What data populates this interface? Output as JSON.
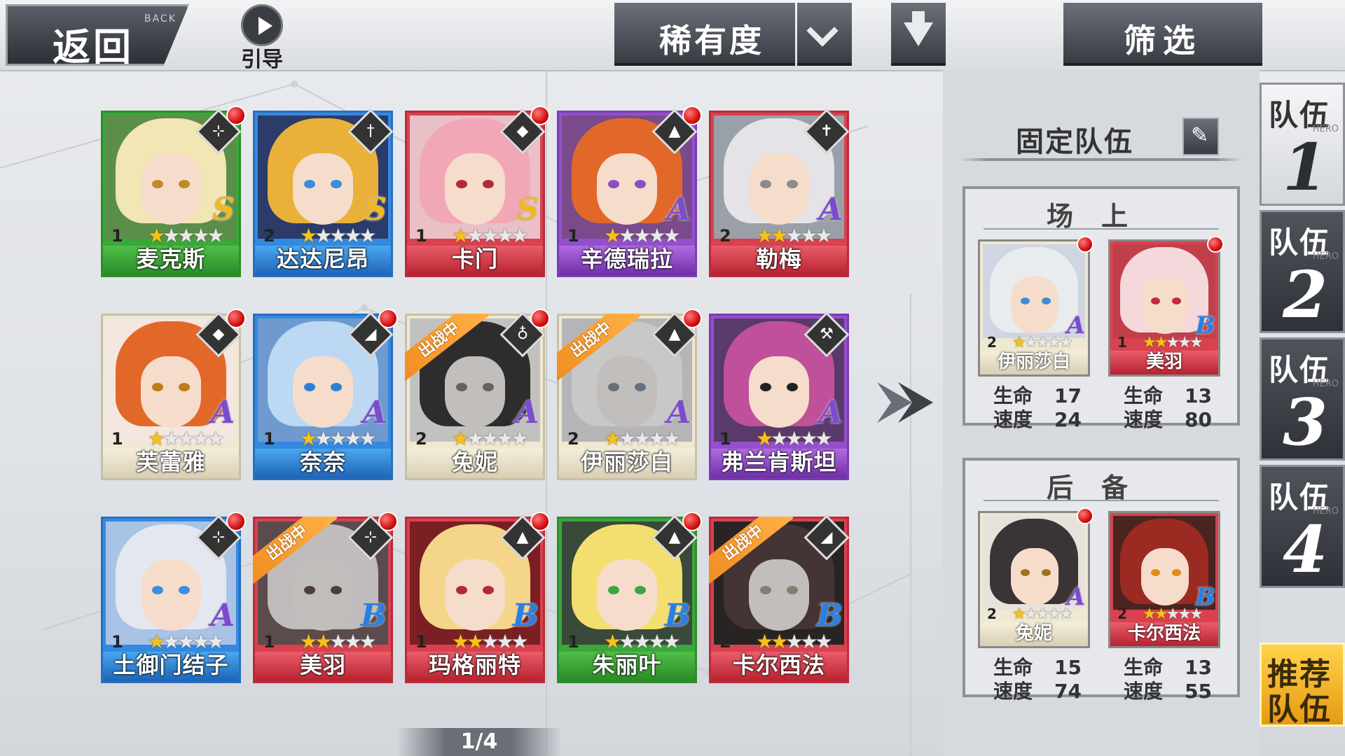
{
  "topbar": {
    "back_label": "返回",
    "back_sub": "BACK",
    "guide_label": "引导",
    "sort_label": "稀有度",
    "filter_label": "筛选"
  },
  "colors": {
    "green": "#3ba63a",
    "blue": "#3389e0",
    "red": "#d9414f",
    "purple": "#9450cc",
    "cream": "#efe8d2",
    "deployed": "#f08a1e",
    "badge": "#d30f0f"
  },
  "cards": [
    {
      "name": "麦克斯",
      "level": "1",
      "stars": 1,
      "grade": "S",
      "frame": "green",
      "icon": "crossbow-icon",
      "badge": true,
      "deployed": false,
      "hair": "#f1e6b4",
      "eye": "#c08a2a",
      "bg": "#5b8e4a"
    },
    {
      "name": "达达尼昂",
      "level": "2",
      "stars": 1,
      "grade": "S",
      "frame": "blue",
      "icon": "sword-icon",
      "badge": false,
      "deployed": false,
      "hair": "#e9b13a",
      "eye": "#3a8de0",
      "bg": "#2b3b6a"
    },
    {
      "name": "卡门",
      "level": "1",
      "stars": 1,
      "grade": "S",
      "frame": "red",
      "icon": "mask-icon",
      "badge": true,
      "deployed": false,
      "hair": "#f2a7b7",
      "eye": "#b3283a",
      "bg": "#e8c0c6"
    },
    {
      "name": "辛德瑞拉",
      "level": "1",
      "stars": 1,
      "grade": "A",
      "frame": "purple",
      "icon": "rocket-icon",
      "badge": true,
      "deployed": false,
      "hair": "#e2682a",
      "eye": "#8a4fc0",
      "bg": "#7a4a8a"
    },
    {
      "name": "勒梅",
      "level": "2",
      "stars": 2,
      "grade": "A",
      "frame": "red",
      "icon": "cross-icon",
      "badge": false,
      "deployed": false,
      "hair": "#e4e4e8",
      "eye": "#8b8b8b",
      "bg": "#9aa0a8"
    },
    {
      "name": "芙蕾雅",
      "level": "1",
      "stars": 1,
      "grade": "A",
      "frame": "cream",
      "icon": "mask-icon",
      "badge": true,
      "deployed": false,
      "hair": "#e2682a",
      "eye": "#c07a1a",
      "bg": "#f3e7e0"
    },
    {
      "name": "奈奈",
      "level": "1",
      "stars": 1,
      "grade": "A",
      "frame": "blue",
      "icon": "hat-icon",
      "badge": true,
      "deployed": false,
      "hair": "#bcd8f2",
      "eye": "#2f7fd8",
      "bg": "#6e9ad0"
    },
    {
      "name": "兔妮",
      "level": "2",
      "stars": 1,
      "grade": "A",
      "frame": "cream",
      "icon": "flask-icon",
      "badge": true,
      "deployed": true,
      "hair": "#3a3436",
      "eye": "#a0701e",
      "bg": "#e8e2dc"
    },
    {
      "name": "伊丽莎白",
      "level": "2",
      "stars": 1,
      "grade": "A",
      "frame": "cream",
      "icon": "rocket-icon",
      "badge": true,
      "deployed": true,
      "hair": "#e9ecef",
      "eye": "#3d8ed8",
      "bg": "#cfd6e2"
    },
    {
      "name": "弗兰肯斯坦",
      "level": "1",
      "stars": 1,
      "grade": "A",
      "frame": "purple",
      "icon": "hammer-icon",
      "badge": false,
      "deployed": false,
      "hair": "#c0509a",
      "eye": "#222222",
      "bg": "#5a3a6a"
    },
    {
      "name": "土御门结子",
      "level": "1",
      "stars": 1,
      "grade": "A",
      "frame": "blue",
      "icon": "crossbow-icon",
      "badge": true,
      "deployed": false,
      "hair": "#e3e8f0",
      "eye": "#3b8fe0",
      "bg": "#a9c3e6"
    },
    {
      "name": "美羽",
      "level": "1",
      "stars": 2,
      "grade": "B",
      "frame": "red",
      "icon": "crossbow-icon",
      "badge": true,
      "deployed": true,
      "hair": "#f4d8dc",
      "eye": "#c22a3a",
      "bg": "#c0404a"
    },
    {
      "name": "玛格丽特",
      "level": "1",
      "stars": 2,
      "grade": "B",
      "frame": "red",
      "icon": "rocket-icon",
      "badge": true,
      "deployed": false,
      "hair": "#f5d58a",
      "eye": "#b3283a",
      "bg": "#7a1f24"
    },
    {
      "name": "朱丽叶",
      "level": "1",
      "stars": 1,
      "grade": "B",
      "frame": "green",
      "icon": "rocket-icon",
      "badge": true,
      "deployed": false,
      "hair": "#f3df70",
      "eye": "#3aa640",
      "bg": "#3a4a3a"
    },
    {
      "name": "卡尔西法",
      "level": "2",
      "stars": 2,
      "grade": "B",
      "frame": "red",
      "icon": "hat-icon",
      "badge": false,
      "deployed": true,
      "hair": "#9b2b22",
      "eye": "#e08a1a",
      "bg": "#4a2420"
    }
  ],
  "panel": {
    "title": "固定队伍",
    "onfield_title": "场上",
    "reserve_title": "后备",
    "hp_label": "生命",
    "speed_label": "速度",
    "onfield": [
      {
        "name": "伊丽莎白",
        "level": "2",
        "stars": 1,
        "grade": "A",
        "frame": "cream",
        "badge": true,
        "hair": "#e9ecef",
        "eye": "#3d8ed8",
        "bg": "#cfd6e2",
        "hp": "17",
        "speed": "24"
      },
      {
        "name": "美羽",
        "level": "1",
        "stars": 2,
        "grade": "B",
        "frame": "red",
        "badge": true,
        "hair": "#f4d8dc",
        "eye": "#c22a3a",
        "bg": "#c0404a",
        "hp": "13",
        "speed": "80"
      }
    ],
    "reserve": [
      {
        "name": "兔妮",
        "level": "2",
        "stars": 1,
        "grade": "A",
        "frame": "cream",
        "badge": true,
        "hair": "#3a3436",
        "eye": "#a0701e",
        "bg": "#e8e2dc",
        "hp": "15",
        "speed": "74"
      },
      {
        "name": "卡尔西法",
        "level": "2",
        "stars": 2,
        "grade": "B",
        "frame": "red",
        "badge": false,
        "hair": "#9b2b22",
        "eye": "#e08a1a",
        "bg": "#4a2420",
        "hp": "13",
        "speed": "55"
      }
    ]
  },
  "tabs": [
    {
      "label": "队伍",
      "num": "1",
      "hero": "HERO",
      "active": true
    },
    {
      "label": "队伍",
      "num": "2",
      "hero": "HERO",
      "active": false
    },
    {
      "label": "队伍",
      "num": "3",
      "hero": "HERO",
      "active": false
    },
    {
      "label": "队伍",
      "num": "4",
      "hero": "HERO",
      "active": false
    }
  ],
  "recommend": {
    "line1": "推荐",
    "line2": "队伍"
  },
  "deployed_label": "出战中",
  "pager": "1/4"
}
